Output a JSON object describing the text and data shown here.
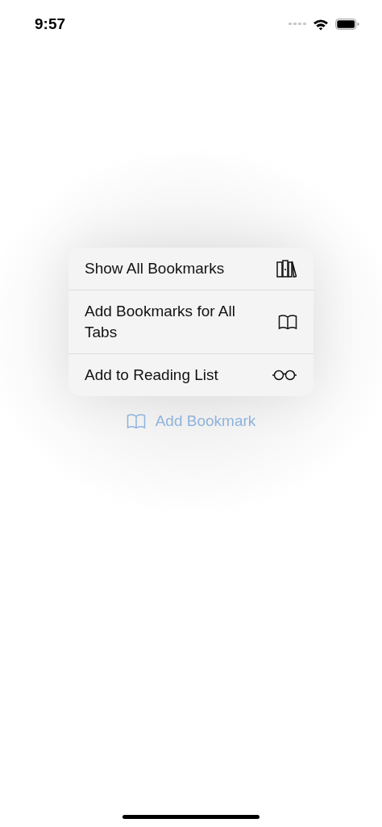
{
  "status_bar": {
    "time": "9:57"
  },
  "menu": {
    "items": [
      {
        "label": "Show All Bookmarks",
        "kind": "books"
      },
      {
        "label": "Add Bookmarks for All Tabs",
        "kind": "book"
      },
      {
        "label": "Add to Reading List",
        "kind": "glasses"
      }
    ]
  },
  "add_bookmark_button": {
    "label": "Add Bookmark"
  }
}
